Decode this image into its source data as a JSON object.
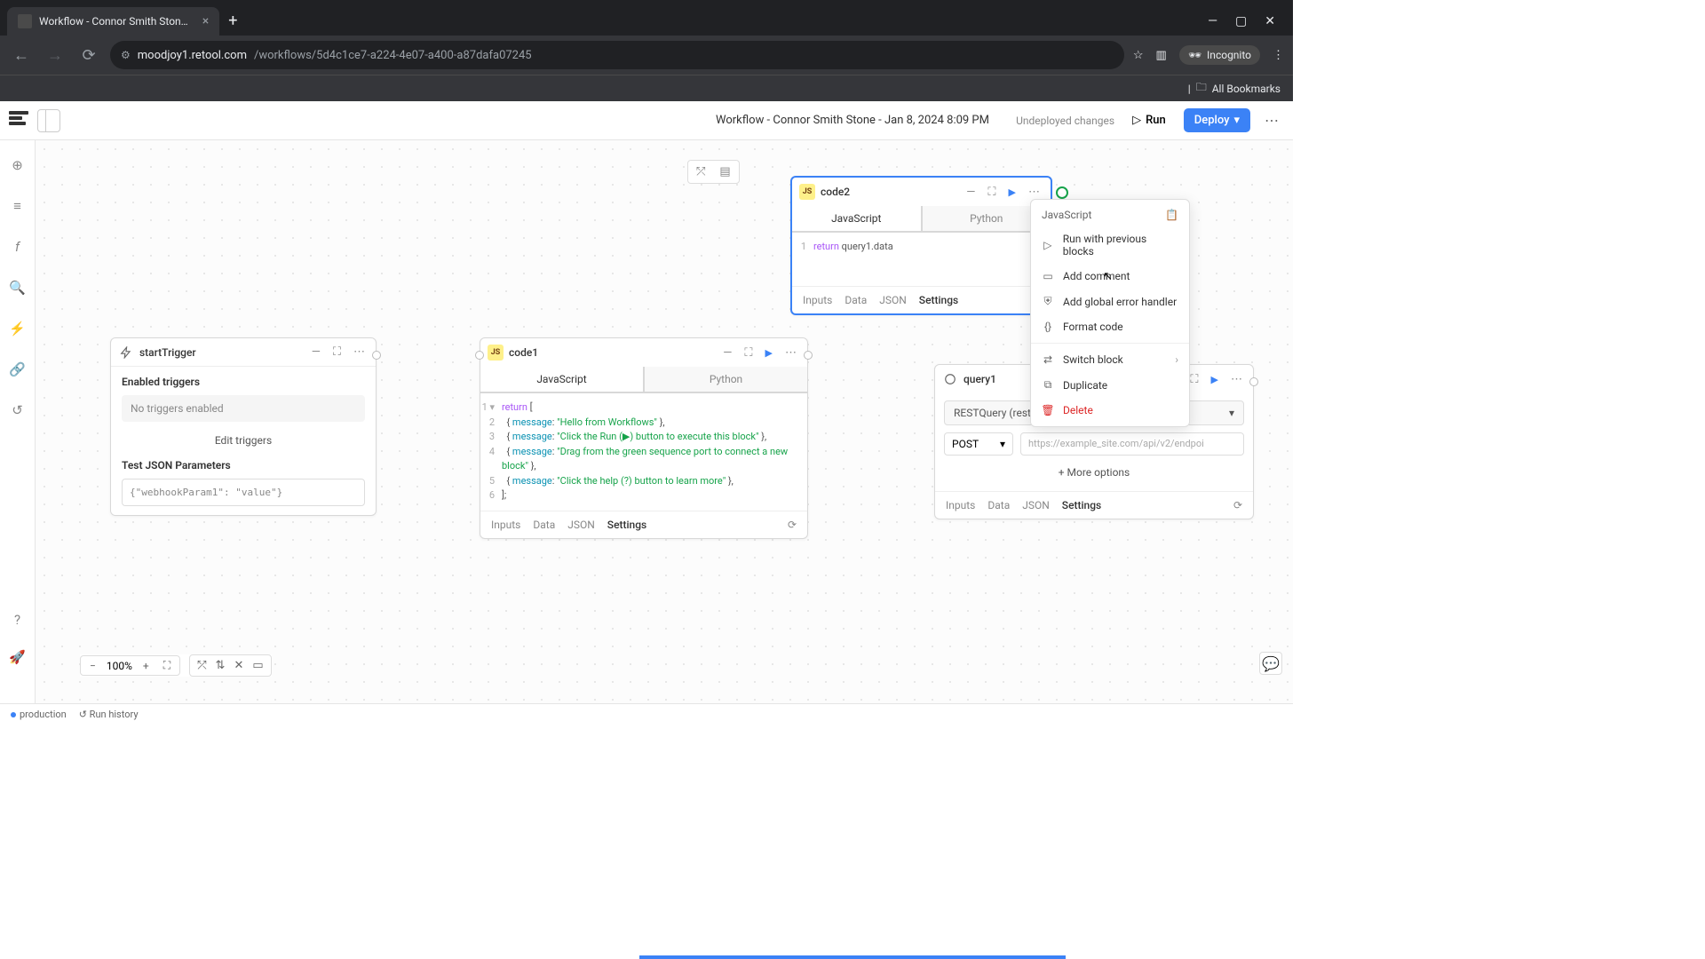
{
  "browser": {
    "tab_title": "Workflow - Connor Smith Ston…",
    "url_host": "moodjoy1.retool.com",
    "url_path": "/workflows/5d4c1ce7-a224-4e07-a400-a87dafa07245",
    "incognito": "Incognito",
    "all_bookmarks": "All Bookmarks"
  },
  "header": {
    "title": "Workflow - Connor Smith Stone - Jan 8, 2024 8:09 PM",
    "undeployed": "Undeployed changes",
    "run": "Run",
    "deploy": "Deploy"
  },
  "start_trigger": {
    "title": "startTrigger",
    "enabled_label": "Enabled triggers",
    "no_triggers": "No triggers enabled",
    "edit_triggers": "Edit triggers",
    "test_params_label": "Test JSON Parameters",
    "test_params_value": "{\"webhookParam1\": \"value\"}"
  },
  "code1": {
    "title": "code1",
    "tabs": {
      "js": "JavaScript",
      "py": "Python"
    },
    "lines": {
      "l1_kw": "return",
      "l1_rest": " [",
      "l2_prop": "message",
      "l2_str": "\"Hello from Workflows\"",
      "l3_prop": "message",
      "l3_str": "\"Click the Run (▶) button to execute this block\"",
      "l4_prop": "message",
      "l4_str": "\"Drag from the green sequence port to connect a new block\"",
      "l5_prop": "message",
      "l5_str": "\"Click the help (?) button to learn more\"",
      "l6": "];"
    },
    "footer": {
      "inputs": "Inputs",
      "data": "Data",
      "json": "JSON",
      "settings": "Settings"
    }
  },
  "code2": {
    "title": "code2",
    "tabs": {
      "js": "JavaScript",
      "py": "Python"
    },
    "line": {
      "kw": "return",
      "rest": " query1.data"
    },
    "footer": {
      "inputs": "Inputs",
      "data": "Data",
      "json": "JSON",
      "settings": "Settings"
    }
  },
  "query1": {
    "title": "query1",
    "resource": "RESTQuery (restapi)",
    "method": "POST",
    "url_placeholder": "https://example_site.com/api/v2/endpoi",
    "more_options": "More options",
    "footer": {
      "inputs": "Inputs",
      "data": "Data",
      "json": "JSON",
      "settings": "Settings"
    }
  },
  "context_menu": {
    "header": "JavaScript",
    "run_prev": "Run with previous blocks",
    "add_comment": "Add comment",
    "add_error": "Add global error handler",
    "format": "Format code",
    "switch": "Switch block",
    "duplicate": "Duplicate",
    "delete": "Delete"
  },
  "zoom": {
    "level": "100%"
  },
  "status": {
    "env": "production",
    "run_history": "Run history"
  }
}
